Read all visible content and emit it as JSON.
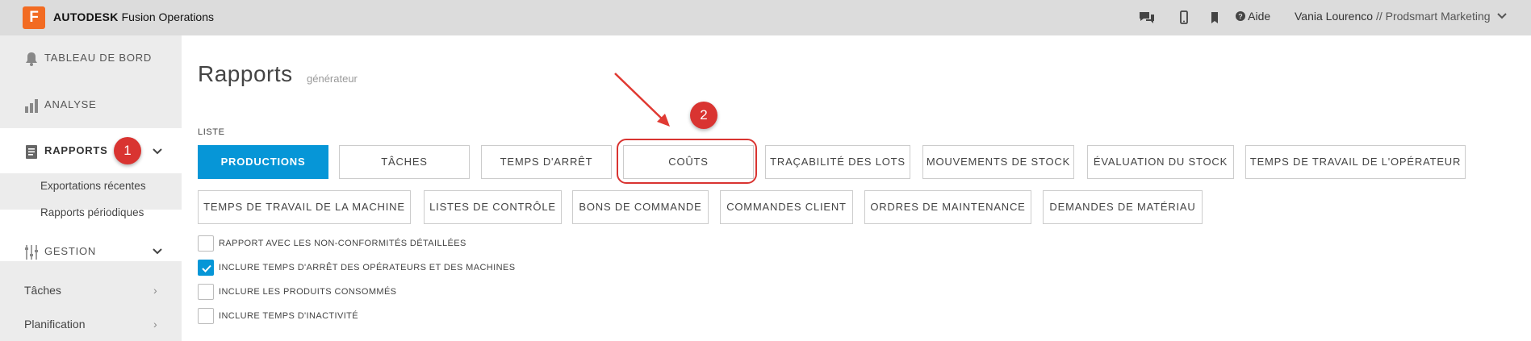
{
  "header": {
    "logo_letter": "F",
    "brand_bold": "AUTODESK",
    "brand_rest": "Fusion Operations",
    "help_label": "Aide",
    "user_name": "Vania Lourenco",
    "org_separator": "//",
    "org_name": "Prodsmart Marketing",
    "icons": [
      "chat-icon",
      "mobile-icon",
      "bookmark-icon",
      "help-icon",
      "chevron-down-icon"
    ]
  },
  "sidebar": {
    "items": [
      {
        "label": "TABLEAU DE BORD",
        "icon": "bell-icon"
      },
      {
        "label": "ANALYSE",
        "icon": "bar-chart-icon"
      },
      {
        "label": "RAPPORTS",
        "icon": "report-icon",
        "active": true
      },
      {
        "label": "GESTION",
        "icon": "sliders-icon"
      }
    ],
    "report_subitems": [
      "Exportations récentes",
      "Rapports périodiques"
    ],
    "gestion_subitems": [
      "Tâches",
      "Planification"
    ]
  },
  "annotations": {
    "badge_1": "1",
    "badge_2": "2",
    "colors": {
      "badge": "#d93431",
      "primary": "#0696d7"
    }
  },
  "main": {
    "title": "Rapports",
    "subtitle": "générateur",
    "list_label": "LISTE",
    "report_buttons": [
      "PRODUCTIONS",
      "TÂCHES",
      "TEMPS D'ARRÊT",
      "COÛTS",
      "TRAÇABILITÉ DES LOTS",
      "MOUVEMENTS DE STOCK",
      "ÉVALUATION DU STOCK",
      "TEMPS DE TRAVAIL DE L'OPÉRATEUR",
      "TEMPS DE TRAVAIL DE LA MACHINE",
      "LISTES DE CONTRÔLE",
      "BONS DE COMMANDE",
      "COMMANDES CLIENT",
      "ORDRES DE MAINTENANCE",
      "DEMANDES DE MATÉRIAU"
    ],
    "selected_report": "PRODUCTIONS",
    "options": [
      {
        "label": "RAPPORT AVEC LES NON-CONFORMITÉS DÉTAILLÉES",
        "checked": false
      },
      {
        "label": "INCLURE TEMPS D'ARRÊT DES OPÉRATEURS ET DES MACHINES",
        "checked": true
      },
      {
        "label": "INCLURE LES PRODUITS CONSOMMÉS",
        "checked": false
      },
      {
        "label": "INCLURE TEMPS D'INACTIVITÉ",
        "checked": false
      }
    ]
  }
}
